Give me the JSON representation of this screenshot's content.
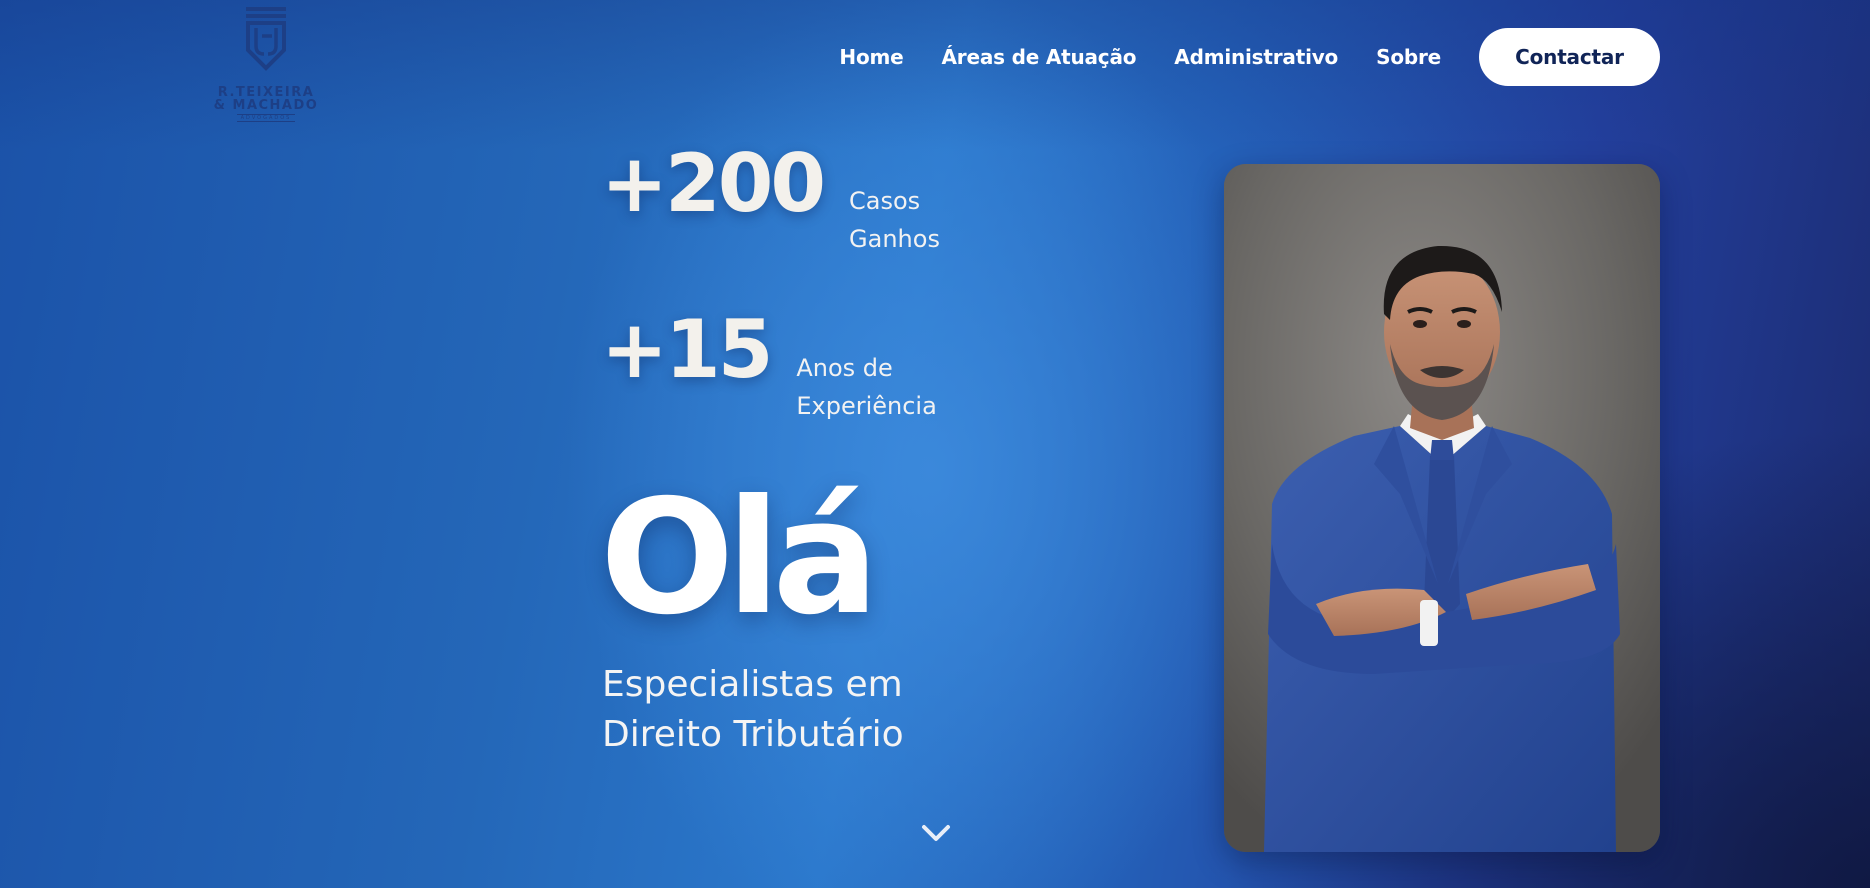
{
  "header": {
    "logo": {
      "name_line1": "R.TEIXEIRA",
      "name_line2": "& MACHADO",
      "tagline": "ADVOGADOS",
      "icon": "shield-monogram-logo"
    },
    "nav": [
      {
        "label": "Home"
      },
      {
        "label": "Áreas de Atuação"
      },
      {
        "label": "Administrativo"
      },
      {
        "label": "Sobre"
      }
    ],
    "cta_label": "Contactar"
  },
  "hero": {
    "stats": [
      {
        "value": "+200",
        "label": "Casos Ganhos"
      },
      {
        "value": "+15",
        "label": "Anos de Experiência"
      }
    ],
    "greeting": "Olá",
    "subtitle": "Especialistas em Direito Tributário",
    "scroll_icon": "chevron-down-icon",
    "portrait_alt": "lawyer-portrait"
  },
  "colors": {
    "background_main": "#2467b8",
    "background_dark": "#1b2a6e",
    "logo_color": "#1d3f86",
    "cta_bg": "#ffffff",
    "cta_text": "#102457",
    "stat_text": "#f3f1ec"
  }
}
